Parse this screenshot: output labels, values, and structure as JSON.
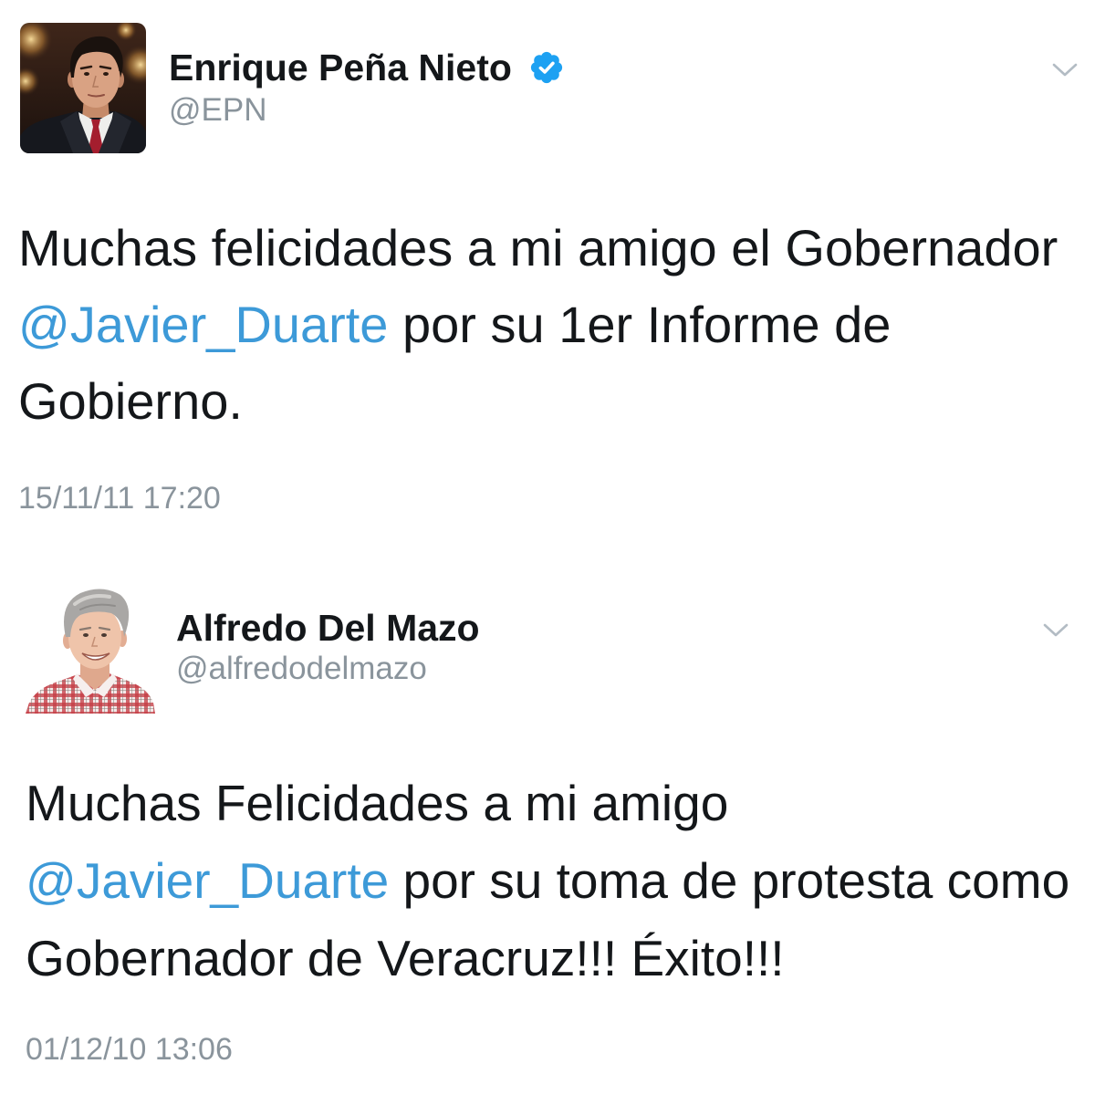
{
  "colors": {
    "background": "#ffffff",
    "text": "#14171a",
    "link": "#3d9ad8",
    "secondary": "#8a949c",
    "verified": "#1da1f2",
    "chevron": "#b3bcc4"
  },
  "icons": {
    "verified": "verified-badge-icon",
    "menu": "chevron-down-icon"
  },
  "tweets": [
    {
      "author": {
        "name": "Enrique Peña Nieto",
        "handle": "@EPN",
        "verified": true
      },
      "body": {
        "line1": "Muchas felicidades a mi amigo el Gobernador",
        "mention": "@Javier_Duarte",
        "line2_rest": "por su 1er Informe de",
        "line3": "Gobierno."
      },
      "timestamp": "15/11/11 17:20"
    },
    {
      "author": {
        "name": "Alfredo Del Mazo",
        "handle": "@alfredodelmazo",
        "verified": false
      },
      "body": {
        "line1": "Muchas Felicidades a mi amigo",
        "mention": "@Javier_Duarte",
        "line2_rest": "por su toma de protesta como",
        "line3": "Gobernador de Veracruz!!! Éxito!!!"
      },
      "timestamp": "01/12/10 13:06"
    }
  ]
}
